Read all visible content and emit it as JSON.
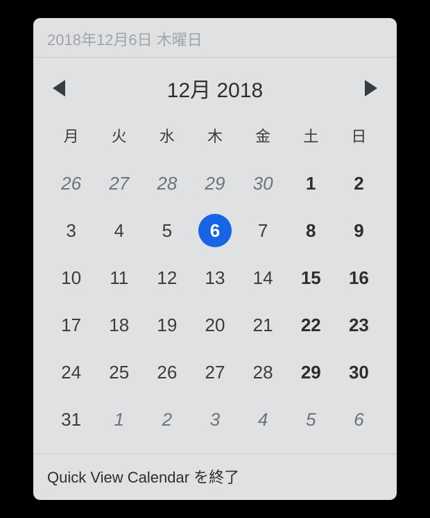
{
  "header": {
    "date_text": "2018年12月6日 木曜日"
  },
  "month_nav": {
    "title": "12月 2018"
  },
  "weekdays": [
    "月",
    "火",
    "水",
    "木",
    "金",
    "土",
    "日"
  ],
  "weeks": [
    [
      {
        "day": "26",
        "other_month": true,
        "weekend": false,
        "today": false
      },
      {
        "day": "27",
        "other_month": true,
        "weekend": false,
        "today": false
      },
      {
        "day": "28",
        "other_month": true,
        "weekend": false,
        "today": false
      },
      {
        "day": "29",
        "other_month": true,
        "weekend": false,
        "today": false
      },
      {
        "day": "30",
        "other_month": true,
        "weekend": false,
        "today": false
      },
      {
        "day": "1",
        "other_month": false,
        "weekend": true,
        "today": false
      },
      {
        "day": "2",
        "other_month": false,
        "weekend": true,
        "today": false
      }
    ],
    [
      {
        "day": "3",
        "other_month": false,
        "weekend": false,
        "today": false
      },
      {
        "day": "4",
        "other_month": false,
        "weekend": false,
        "today": false
      },
      {
        "day": "5",
        "other_month": false,
        "weekend": false,
        "today": false
      },
      {
        "day": "6",
        "other_month": false,
        "weekend": false,
        "today": true
      },
      {
        "day": "7",
        "other_month": false,
        "weekend": false,
        "today": false
      },
      {
        "day": "8",
        "other_month": false,
        "weekend": true,
        "today": false
      },
      {
        "day": "9",
        "other_month": false,
        "weekend": true,
        "today": false
      }
    ],
    [
      {
        "day": "10",
        "other_month": false,
        "weekend": false,
        "today": false
      },
      {
        "day": "11",
        "other_month": false,
        "weekend": false,
        "today": false
      },
      {
        "day": "12",
        "other_month": false,
        "weekend": false,
        "today": false
      },
      {
        "day": "13",
        "other_month": false,
        "weekend": false,
        "today": false
      },
      {
        "day": "14",
        "other_month": false,
        "weekend": false,
        "today": false
      },
      {
        "day": "15",
        "other_month": false,
        "weekend": true,
        "today": false
      },
      {
        "day": "16",
        "other_month": false,
        "weekend": true,
        "today": false
      }
    ],
    [
      {
        "day": "17",
        "other_month": false,
        "weekend": false,
        "today": false
      },
      {
        "day": "18",
        "other_month": false,
        "weekend": false,
        "today": false
      },
      {
        "day": "19",
        "other_month": false,
        "weekend": false,
        "today": false
      },
      {
        "day": "20",
        "other_month": false,
        "weekend": false,
        "today": false
      },
      {
        "day": "21",
        "other_month": false,
        "weekend": false,
        "today": false
      },
      {
        "day": "22",
        "other_month": false,
        "weekend": true,
        "today": false
      },
      {
        "day": "23",
        "other_month": false,
        "weekend": true,
        "today": false
      }
    ],
    [
      {
        "day": "24",
        "other_month": false,
        "weekend": false,
        "today": false
      },
      {
        "day": "25",
        "other_month": false,
        "weekend": false,
        "today": false
      },
      {
        "day": "26",
        "other_month": false,
        "weekend": false,
        "today": false
      },
      {
        "day": "27",
        "other_month": false,
        "weekend": false,
        "today": false
      },
      {
        "day": "28",
        "other_month": false,
        "weekend": false,
        "today": false
      },
      {
        "day": "29",
        "other_month": false,
        "weekend": true,
        "today": false
      },
      {
        "day": "30",
        "other_month": false,
        "weekend": true,
        "today": false
      }
    ],
    [
      {
        "day": "31",
        "other_month": false,
        "weekend": false,
        "today": false
      },
      {
        "day": "1",
        "other_month": true,
        "weekend": false,
        "today": false
      },
      {
        "day": "2",
        "other_month": true,
        "weekend": false,
        "today": false
      },
      {
        "day": "3",
        "other_month": true,
        "weekend": false,
        "today": false
      },
      {
        "day": "4",
        "other_month": true,
        "weekend": false,
        "today": false
      },
      {
        "day": "5",
        "other_month": true,
        "weekend": false,
        "today": false
      },
      {
        "day": "6",
        "other_month": true,
        "weekend": false,
        "today": false
      }
    ]
  ],
  "footer": {
    "quit_label": "Quick View Calendar を終了"
  }
}
